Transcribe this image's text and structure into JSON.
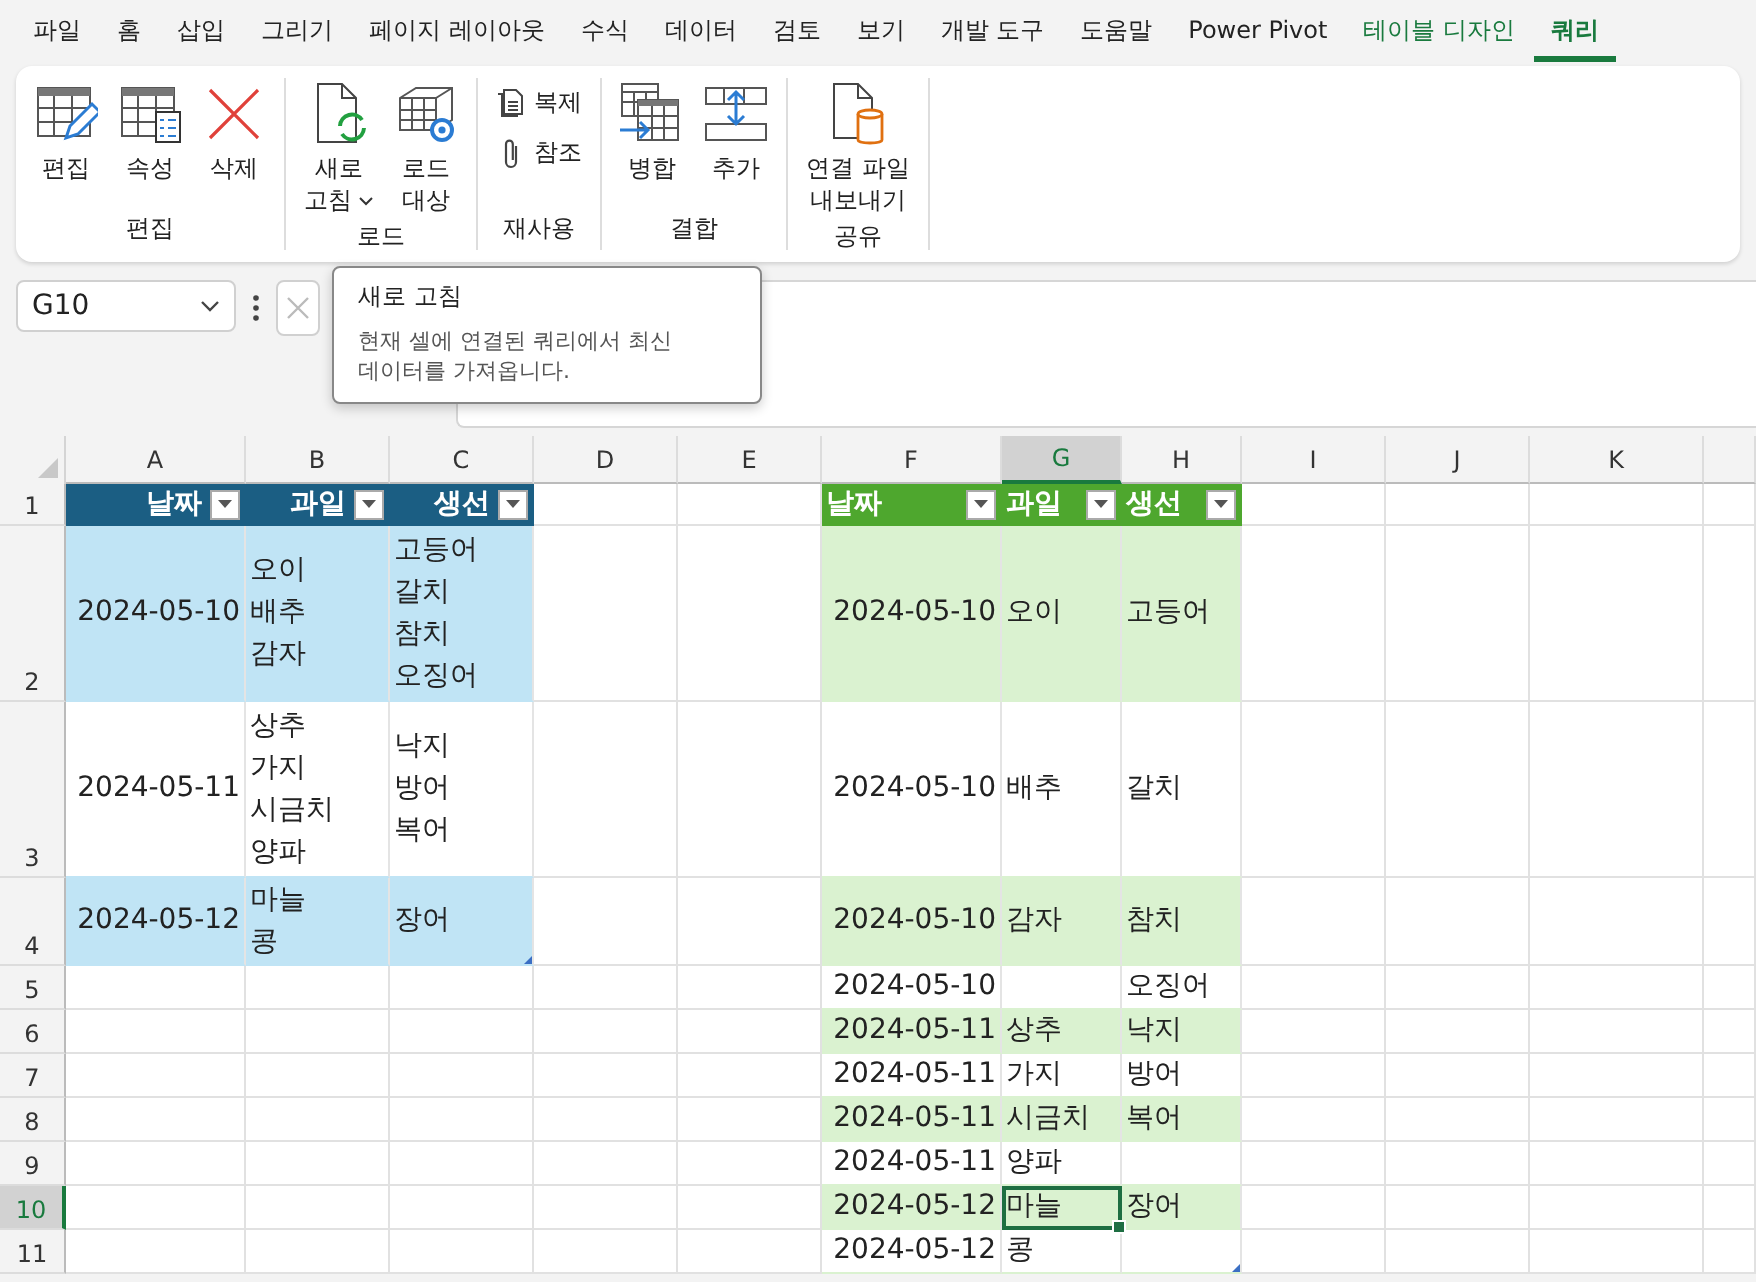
{
  "menu_tabs": [
    {
      "label": "파일",
      "selected": false,
      "kind": "standard"
    },
    {
      "label": "홈",
      "selected": false,
      "kind": "standard"
    },
    {
      "label": "삽입",
      "selected": false,
      "kind": "standard"
    },
    {
      "label": "그리기",
      "selected": false,
      "kind": "standard"
    },
    {
      "label": "페이지 레이아웃",
      "selected": false,
      "kind": "standard"
    },
    {
      "label": "수식",
      "selected": false,
      "kind": "standard"
    },
    {
      "label": "데이터",
      "selected": false,
      "kind": "standard"
    },
    {
      "label": "검토",
      "selected": false,
      "kind": "standard"
    },
    {
      "label": "보기",
      "selected": false,
      "kind": "standard"
    },
    {
      "label": "개발 도구",
      "selected": false,
      "kind": "standard"
    },
    {
      "label": "도움말",
      "selected": false,
      "kind": "standard"
    },
    {
      "label": "Power Pivot",
      "selected": false,
      "kind": "standard"
    },
    {
      "label": "테이블 디자인",
      "selected": false,
      "kind": "contextual"
    },
    {
      "label": "쿼리",
      "selected": true,
      "kind": "contextual"
    }
  ],
  "ribbon": {
    "groups": [
      {
        "label": "편집",
        "buttons": [
          {
            "label": "편집",
            "kind": "large"
          },
          {
            "label": "속성",
            "kind": "large"
          },
          {
            "label": "삭제",
            "kind": "large"
          }
        ]
      },
      {
        "label": "로드",
        "buttons": [
          {
            "label": "새로\n고침",
            "kind": "large",
            "dropdown": true
          },
          {
            "label": "로드\n대상",
            "kind": "large"
          }
        ]
      },
      {
        "label": "재사용",
        "buttons": [
          {
            "label": "복제",
            "kind": "small"
          },
          {
            "label": "참조",
            "kind": "small"
          }
        ]
      },
      {
        "label": "결합",
        "buttons": [
          {
            "label": "병합",
            "kind": "large"
          },
          {
            "label": "추가",
            "kind": "large"
          }
        ]
      },
      {
        "label": "공유",
        "buttons": [
          {
            "label": "연결 파일\n내보내기",
            "kind": "large"
          }
        ]
      }
    ]
  },
  "name_box": {
    "value": "G10"
  },
  "tooltip": {
    "title": "새로 고침",
    "text": "현재 셀에 연결된 쿼리에서 최신\n데이터를 가져옵니다."
  },
  "sheet": {
    "columns": [
      {
        "label": "A",
        "selected": false
      },
      {
        "label": "B",
        "selected": false
      },
      {
        "label": "C",
        "selected": false
      },
      {
        "label": "D",
        "selected": false
      },
      {
        "label": "E",
        "selected": false
      },
      {
        "label": "F",
        "selected": false
      },
      {
        "label": "G",
        "selected": true
      },
      {
        "label": "H",
        "selected": false
      },
      {
        "label": "I",
        "selected": false
      },
      {
        "label": "J",
        "selected": false
      },
      {
        "label": "K",
        "selected": false
      }
    ],
    "rows": [
      {
        "label": "1",
        "selected": false
      },
      {
        "label": "2",
        "selected": false
      },
      {
        "label": "3",
        "selected": false
      },
      {
        "label": "4",
        "selected": false
      },
      {
        "label": "5",
        "selected": false
      },
      {
        "label": "6",
        "selected": false
      },
      {
        "label": "7",
        "selected": false
      },
      {
        "label": "8",
        "selected": false
      },
      {
        "label": "9",
        "selected": false
      },
      {
        "label": "10",
        "selected": true
      },
      {
        "label": "11",
        "selected": false
      }
    ],
    "tables": [
      {
        "kind": "blue",
        "columns": [
          "날짜",
          "과일",
          "생선"
        ],
        "rows": [
          {
            "cells": [
              "2024-05-10",
              "오이\n배추\n감자",
              "고등어\n갈치\n참치\n오징어"
            ]
          },
          {
            "cells": [
              "2024-05-11",
              "상추\n가지\n시금치\n양파",
              "낙지\n방어\n복어"
            ]
          },
          {
            "cells": [
              "2024-05-12",
              "마늘\n콩",
              "장어"
            ]
          }
        ]
      },
      {
        "kind": "green",
        "columns": [
          "날짜",
          "과일",
          "생선"
        ],
        "rows": [
          {
            "cells": [
              "2024-05-10",
              "오이",
              "고등어"
            ]
          },
          {
            "cells": [
              "2024-05-10",
              "배추",
              "갈치"
            ]
          },
          {
            "cells": [
              "2024-05-10",
              "감자",
              "참치"
            ]
          },
          {
            "cells": [
              "2024-05-10",
              null,
              "오징어"
            ]
          },
          {
            "cells": [
              "2024-05-11",
              "상추",
              "낙지"
            ]
          },
          {
            "cells": [
              "2024-05-11",
              "가지",
              "방어"
            ]
          },
          {
            "cells": [
              "2024-05-11",
              "시금치",
              "복어"
            ]
          },
          {
            "cells": [
              "2024-05-11",
              "양파",
              null
            ]
          },
          {
            "cells": [
              "2024-05-12",
              "마늘",
              "장어"
            ]
          },
          {
            "cells": [
              "2024-05-12",
              "콩",
              null
            ]
          }
        ]
      }
    ]
  }
}
